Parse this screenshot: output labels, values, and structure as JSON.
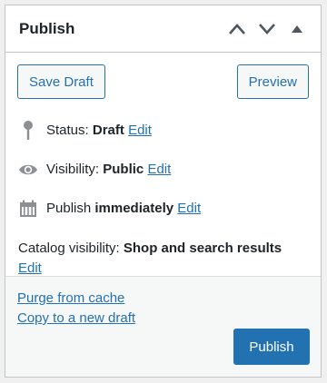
{
  "panel": {
    "title": "Publish",
    "controls": [
      {
        "icon": "chevron-up-icon"
      },
      {
        "icon": "chevron-down-icon"
      },
      {
        "icon": "triangle-up-icon"
      }
    ]
  },
  "actions": {
    "save_draft_label": "Save Draft",
    "preview_label": "Preview"
  },
  "status": {
    "icon": "pin-icon",
    "label": "Status:",
    "value": "Draft",
    "edit_label": "Edit"
  },
  "visibility": {
    "icon": "eye-icon",
    "label": "Visibility:",
    "value": "Public",
    "edit_label": "Edit"
  },
  "schedule": {
    "icon": "calendar-icon",
    "label": "Publish",
    "value": "immediately",
    "edit_label": "Edit"
  },
  "catalog": {
    "label": "Catalog visibility:",
    "value": "Shop and search results",
    "edit_label": "Edit"
  },
  "footer": {
    "purge_label": "Purge from cache",
    "copy_label": "Copy to a new draft",
    "publish_label": "Publish"
  },
  "colors": {
    "accent": "#2271b1",
    "text": "#1d2327",
    "icon": "#8c8f94"
  }
}
